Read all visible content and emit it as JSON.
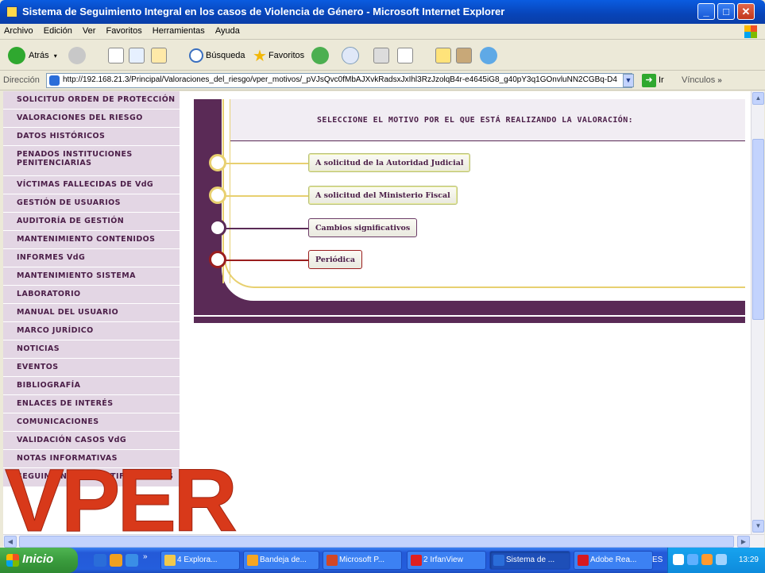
{
  "window": {
    "title": "Sistema de Seguimiento Integral en los casos de Violencia de Género - Microsoft Internet Explorer",
    "buttons": {
      "minimize": "_",
      "maximize": "□",
      "close": "✕"
    }
  },
  "menu": [
    "Archivo",
    "Edición",
    "Ver",
    "Favoritos",
    "Herramientas",
    "Ayuda"
  ],
  "toolbar": {
    "back_label": "Atrás",
    "search_label": "Búsqueda",
    "favorites_label": "Favoritos"
  },
  "address": {
    "label": "Dirección",
    "url": "http://192.168.21.3/Principal/Valoraciones_del_riesgo/vper_motivos/_pVJsQvc0fMbAJXvkRadsxJxIhl3RzJzolqB4r-e4645iG8_g40pY3q1GOnvluNN2CGBq-D4",
    "go_label": "Ir",
    "links_label": "Vínculos"
  },
  "sidebar": {
    "items": [
      "SOLICITUD ORDEN DE PROTECCIÓN",
      "VALORACIONES DEL RIESGO",
      "DATOS HISTÓRICOS",
      "PENADOS INSTITUCIONES PENITENCIARIAS",
      "VÍCTIMAS FALLECIDAS DE VdG",
      "GESTIÓN DE USUARIOS",
      "AUDITORÍA DE GESTIÓN",
      "MANTENIMIENTO CONTENIDOS",
      "INFORMES VdG",
      "MANTENIMIENTO SISTEMA",
      "LABORATORIO",
      "MANUAL DEL USUARIO",
      "MARCO JURÍDICO",
      "NOTICIAS",
      "EVENTOS",
      "BIBLIOGRAFÍA",
      "ENLACES DE INTERÉS",
      "COMUNICACIONES",
      "VALIDACIÓN CASOS VdG",
      "NOTAS INFORMATIVAS",
      "SEGUIMIENTO DE NOTIFICACIONES"
    ]
  },
  "main": {
    "heading": "SELECCIONE EL MOTIVO POR EL QUE ESTÁ REALIZANDO LA VALORACIÓN:",
    "options": [
      {
        "label": "A solicitud de la Autoridad Judicial",
        "color": "#e8d070"
      },
      {
        "label": "A solicitud del Ministerio Fiscal",
        "color": "#e8d070"
      },
      {
        "label": "Cambios significativos",
        "color": "#5a2a56"
      },
      {
        "label": "Periódica",
        "color": "#9a1d1d"
      }
    ]
  },
  "overlay": {
    "text": "VPER",
    "color": "#d8391a"
  },
  "taskbar": {
    "start_label": "Inicio",
    "tasks": [
      "4 Explora...",
      "Bandeja de...",
      "Microsoft P...",
      "2 IrfanView",
      "Sistema de ...",
      "Adobe Rea..."
    ],
    "language": "ES",
    "clock": "13:29"
  }
}
